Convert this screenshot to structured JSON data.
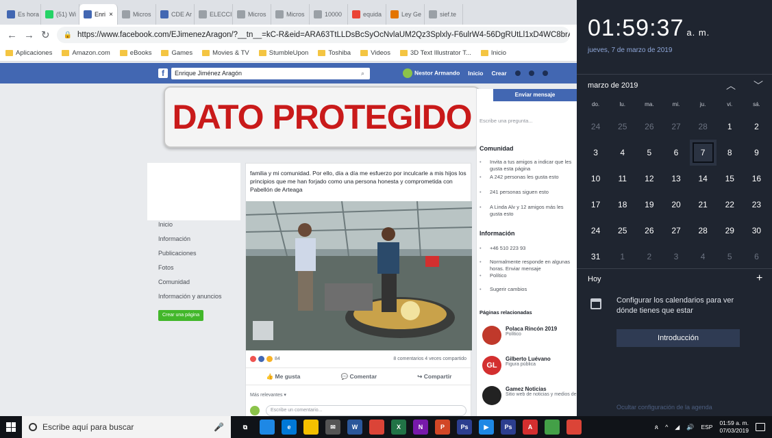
{
  "browser": {
    "tabs": [
      {
        "label": "Es hora",
        "color": "#4267b2"
      },
      {
        "label": "(51) Wi",
        "color": "#25d366"
      },
      {
        "label": "Enri",
        "color": "#4267b2",
        "active": true
      },
      {
        "label": "Micros",
        "color": "#9aa0a6"
      },
      {
        "label": "CDE Ar",
        "color": "#4267b2"
      },
      {
        "label": "ELECCI",
        "color": "#9aa0a6"
      },
      {
        "label": "Micros",
        "color": "#9aa0a6"
      },
      {
        "label": "Micros",
        "color": "#9aa0a6"
      },
      {
        "label": "10000",
        "color": "#9aa0a6"
      },
      {
        "label": "equida",
        "color": "#ea4335"
      },
      {
        "label": "Ley Ge",
        "color": "#e37400"
      },
      {
        "label": "sief.te",
        "color": "#9aa0a6"
      }
    ],
    "url_prefix": "https://www.",
    "url": "https://www.facebook.com/EJimenezAragon/?__tn__=kC-R&eid=ARA63TtLLDsBcSyOcNvlaUM2Qz3Splxly-F6ulrW4-56DgRUtLl1xD4WC8brA",
    "bookmarks": [
      "Aplicaciones",
      "Amazon.com",
      "eBooks",
      "Games",
      "Movies & TV",
      "StumbleUpon",
      "Toshiba",
      "Videos",
      "3D Text Illustrator T...",
      "Inicio"
    ]
  },
  "facebook": {
    "search_value": "Enrique Jiménez Aragón",
    "user_name": "Nestor Armando",
    "nav_home": "Inicio",
    "nav_create": "Crear",
    "left_nav": [
      "Inicio",
      "Información",
      "Publicaciones",
      "Fotos",
      "Comunidad",
      "Información y anuncios"
    ],
    "create_page_button": "Crear una página",
    "protected_stamp": "DATO PROTEGIDO",
    "post_text": "familia y mi comunidad. Por ello, día a día me esfuerzo por inculcarle a mis hijos los principios que me han forjado como una persona honesta y comprometida con Pabellón de Arteaga",
    "reaction_count": "84",
    "comments_shares": "8 comentarios 4 veces compartido",
    "like": "Me gusta",
    "comment": "Comentar",
    "share": "Compartir",
    "most_relevant": "Más relevantes ▾",
    "comment_placeholder": "Escribe un comentario...",
    "send_message": "Enviar mensaje",
    "ask_question": "Escribe una pregunta...",
    "community_title": "Comunidad",
    "community_lines": [
      "Invita a tus amigos a indicar que les gusta esta página",
      "A 242 personas les gusta esto",
      "241 personas siguen esto",
      "A Linda Alv y 12 amigos más les gusta esto"
    ],
    "info_title": "Información",
    "info_lines": [
      "+46 510 223 93",
      "Normalmente responde en algunas horas. Enviar mensaje",
      "Político",
      "Sugerir cambios"
    ],
    "related_title": "Páginas relacionadas",
    "related": [
      {
        "name": "Polaca Rincón 2019",
        "category": "Político",
        "logo": "",
        "color": "#c0392b"
      },
      {
        "name": "Gilberto Luévano",
        "category": "Figura pública",
        "logo": "GL",
        "color": "#d32f2f"
      },
      {
        "name": "Gamez Noticias",
        "category": "Sitio web de noticias y medios de",
        "logo": "",
        "color": "#222222"
      }
    ]
  },
  "calendar": {
    "time": "01:59:37",
    "ampm": "a. m.",
    "long_date": "jueves, 7 de marzo de 2019",
    "month_label": "marzo de 2019",
    "weekdays": [
      "do.",
      "lu.",
      "ma.",
      "mi.",
      "ju.",
      "vi.",
      "sá."
    ],
    "days": [
      {
        "d": "24",
        "other": true
      },
      {
        "d": "25",
        "other": true
      },
      {
        "d": "26",
        "other": true
      },
      {
        "d": "27",
        "other": true
      },
      {
        "d": "28",
        "other": true
      },
      {
        "d": "1"
      },
      {
        "d": "2"
      },
      {
        "d": "3"
      },
      {
        "d": "4"
      },
      {
        "d": "5"
      },
      {
        "d": "6"
      },
      {
        "d": "7",
        "today": true
      },
      {
        "d": "8"
      },
      {
        "d": "9"
      },
      {
        "d": "10"
      },
      {
        "d": "11"
      },
      {
        "d": "12"
      },
      {
        "d": "13"
      },
      {
        "d": "14"
      },
      {
        "d": "15"
      },
      {
        "d": "16"
      },
      {
        "d": "17"
      },
      {
        "d": "18"
      },
      {
        "d": "19"
      },
      {
        "d": "20"
      },
      {
        "d": "21"
      },
      {
        "d": "22"
      },
      {
        "d": "23"
      },
      {
        "d": "24"
      },
      {
        "d": "25"
      },
      {
        "d": "26"
      },
      {
        "d": "27"
      },
      {
        "d": "28"
      },
      {
        "d": "29"
      },
      {
        "d": "30"
      },
      {
        "d": "31"
      },
      {
        "d": "1",
        "other": true
      },
      {
        "d": "2",
        "other": true
      },
      {
        "d": "3",
        "other": true
      },
      {
        "d": "4",
        "other": true
      },
      {
        "d": "5",
        "other": true
      },
      {
        "d": "6",
        "other": true
      }
    ],
    "today_label": "Hoy",
    "config_text": "Configurar los calendarios para ver dónde tienes que estar",
    "intro_button": "Introducción",
    "hide_link": "Ocultar configuración de la agenda"
  },
  "taskbar": {
    "search_placeholder": "Escribe aquí para buscar",
    "apps": [
      {
        "icon": "task-view",
        "color": "#101318",
        "glyph": "⧉"
      },
      {
        "icon": "desktop",
        "color": "#1e88e5",
        "glyph": ""
      },
      {
        "icon": "edge",
        "color": "#0078d7",
        "glyph": "e"
      },
      {
        "icon": "store",
        "color": "#f5c000",
        "glyph": ""
      },
      {
        "icon": "mail",
        "color": "#555555",
        "glyph": "✉"
      },
      {
        "icon": "word",
        "color": "#2b579a",
        "glyph": "W"
      },
      {
        "icon": "chrome",
        "color": "#db4437",
        "glyph": ""
      },
      {
        "icon": "excel",
        "color": "#217346",
        "glyph": "X"
      },
      {
        "icon": "onenote",
        "color": "#7719aa",
        "glyph": "N"
      },
      {
        "icon": "powerpoint",
        "color": "#d24726",
        "glyph": "P"
      },
      {
        "icon": "photoshop",
        "color": "#2c3e8f",
        "glyph": "Ps"
      },
      {
        "icon": "media",
        "color": "#1e88e5",
        "glyph": "▶"
      },
      {
        "icon": "photoshop-2",
        "color": "#2c3e8f",
        "glyph": "Ps"
      },
      {
        "icon": "acrobat",
        "color": "#d32f2f",
        "glyph": "A"
      },
      {
        "icon": "app-green",
        "color": "#43a047",
        "glyph": ""
      },
      {
        "icon": "chrome-2",
        "color": "#db4437",
        "glyph": ""
      }
    ],
    "language": "ESP",
    "clock_time": "01:59 a. m.",
    "clock_date": "07/03/2019"
  }
}
